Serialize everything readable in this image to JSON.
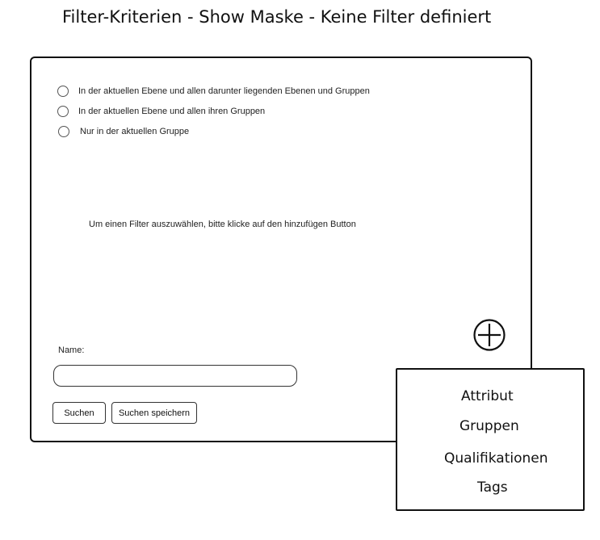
{
  "title": "Filter-Kriterien - Show Maske - Keine Filter definiert",
  "scope_options": [
    {
      "label": "In der aktuellen Ebene und allen darunter liegenden Ebenen und Gruppen",
      "selected": false
    },
    {
      "label": "In der aktuellen Ebene und allen ihren Gruppen",
      "selected": false
    },
    {
      "label": "Nur in der aktuellen Gruppe",
      "selected": false
    }
  ],
  "hint": "Um einen Filter auszuwählen, bitte klicke auf den hinzufügen Button",
  "add_button_icon": "plus-circle-icon",
  "form": {
    "name_label": "Name:",
    "name_value": "",
    "search_label": "Suchen",
    "save_search_label": "Suchen speichern"
  },
  "filter_menu": {
    "items": [
      "Attribut",
      "Gruppen",
      "Qualifikationen",
      "Tags"
    ]
  }
}
